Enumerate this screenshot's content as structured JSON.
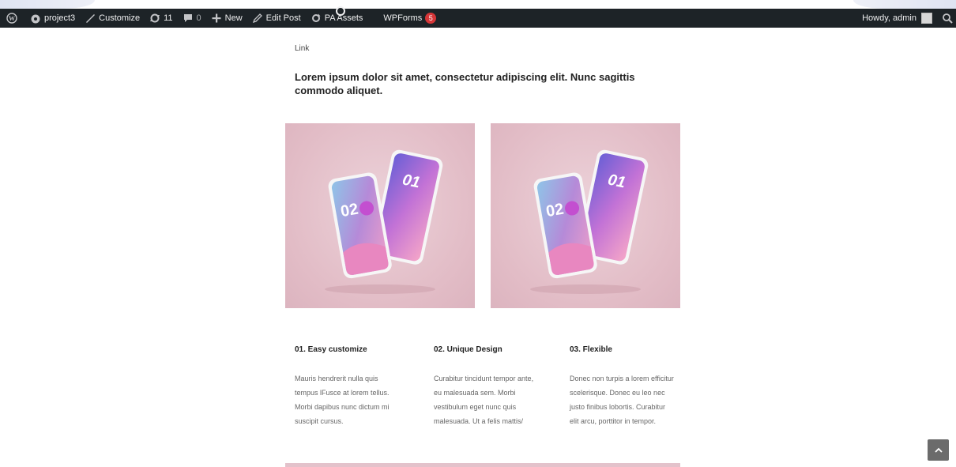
{
  "adminbar": {
    "wp_logo_icon": "wordpress-icon",
    "site_name": "project3",
    "customize_label": "Customize",
    "updates_count": "11",
    "comments_count": "0",
    "new_label": "New",
    "edit_post_label": "Edit Post",
    "pa_assets_label": "PA Assets",
    "wpforms_label": "WPForms",
    "wpforms_badge": "5",
    "howdy_label": "Howdy, admin",
    "search_icon": "search-icon",
    "badge_color": "#d63638",
    "bar_color": "#1d2327"
  },
  "content": {
    "link_label": "Link",
    "headline": "Lorem ipsum dolor sit amet, consectetur adipiscing elit. Nunc sagittis commodo aliquet.",
    "phones": {
      "front_number": "02",
      "back_number": "01"
    },
    "features": [
      {
        "title": "01. Easy customize",
        "body": "Mauris hendrerit nulla quis tempus lFusce at lorem tellus. Morbi dapibus nunc dictum mi suscipit cursus."
      },
      {
        "title": "02. Unique Design",
        "body": "Curabitur tincidunt tempor ante, eu malesuada sem. Morbi vestibulum eget nunc quis malesuada. Ut a felis mattis/"
      },
      {
        "title": "03. Flexible",
        "body": "Donec non turpis a lorem efficitur scelerisque. Donec eu leo nec justo finibus lobortis. Curabitur elit arcu, porttitor in tempor."
      }
    ],
    "accent_color": "#e2bcc6"
  },
  "scroll_top_icon": "chevron-up-icon"
}
